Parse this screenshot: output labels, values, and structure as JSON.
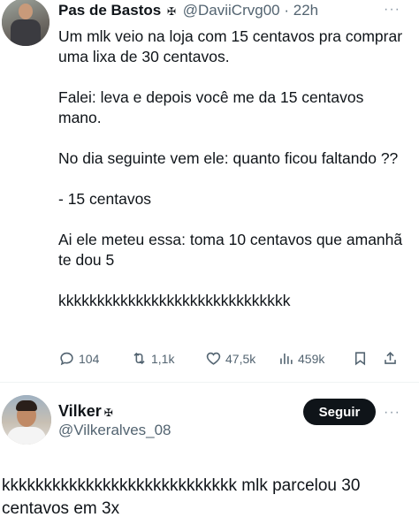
{
  "tweet": {
    "author_name": "Pas de Bastos",
    "author_badge": "✠",
    "author_handle": "@DaviiCrvg00",
    "separator": "·",
    "time": "22h",
    "more": "···",
    "paragraphs": [
      "Um mlk veio na loja com 15 centavos pra comprar uma lixa de 30 centavos.",
      "Falei: leva e depois você me da 15 centavos mano.",
      "No dia seguinte vem ele: quanto ficou faltando ??",
      "- 15 centavos",
      "Ai ele meteu essa: toma 10 centavos que amanhã te dou 5",
      "kkkkkkkkkkkkkkkkkkkkkkkkkkkkkk"
    ],
    "stats": {
      "replies": "104",
      "retweets": "1,1k",
      "likes": "47,5k",
      "views": "459k"
    },
    "icons": {
      "reply": "comment-icon",
      "retweet": "retweet-icon",
      "like": "heart-icon",
      "views": "views-icon",
      "bookmark": "bookmark-icon",
      "share": "share-icon"
    }
  },
  "reply": {
    "author_name": "Vilker",
    "author_badge": "✠",
    "author_handle": "@Vilkeralves_08",
    "follow_label": "Seguir",
    "more": "···",
    "text": "kkkkkkkkkkkkkkkkkkkkkkkkkkkk mlk parcelou 30 centavos em 3x"
  },
  "colors": {
    "text": "#0f1419",
    "secondary": "#536471",
    "follow_bg": "#0f1419"
  }
}
